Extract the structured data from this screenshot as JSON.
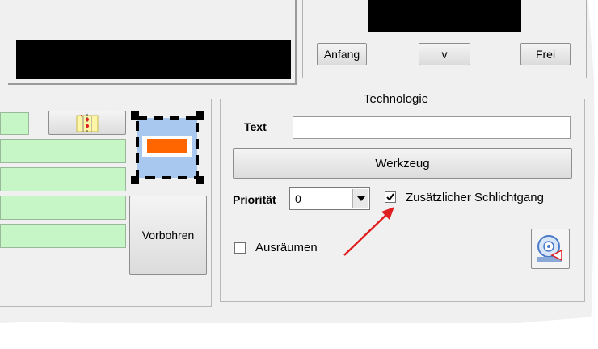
{
  "top_right": {
    "buttons": [
      {
        "label": "Anfang"
      },
      {
        "label": "v"
      },
      {
        "label": "Frei"
      }
    ]
  },
  "left": {
    "vorbohren_label": "Vorbohren"
  },
  "technologie": {
    "title": "Technologie",
    "text_label": "Text",
    "text_value": "",
    "werkzeug_label": "Werkzeug",
    "prioritaet_label": "Priorität",
    "prioritaet_value": "0",
    "schlichtgang_label": "Zusätzlicher Schlichtgang",
    "schlichtgang_checked": true,
    "ausraeumen_label": "Ausräumen",
    "ausraeumen_checked": false
  },
  "icons": {
    "tool_icon": "pocket-tool-icon",
    "disc_icon": "disc-arrow-icon",
    "ruler_icon": "drill-pattern-icon",
    "annotation_arrow": "red-arrow"
  },
  "colors": {
    "green_field": "#c6f5c6",
    "orange": "#ff6600",
    "light_blue": "#a0c4f0",
    "red_arrow": "#e02020"
  }
}
